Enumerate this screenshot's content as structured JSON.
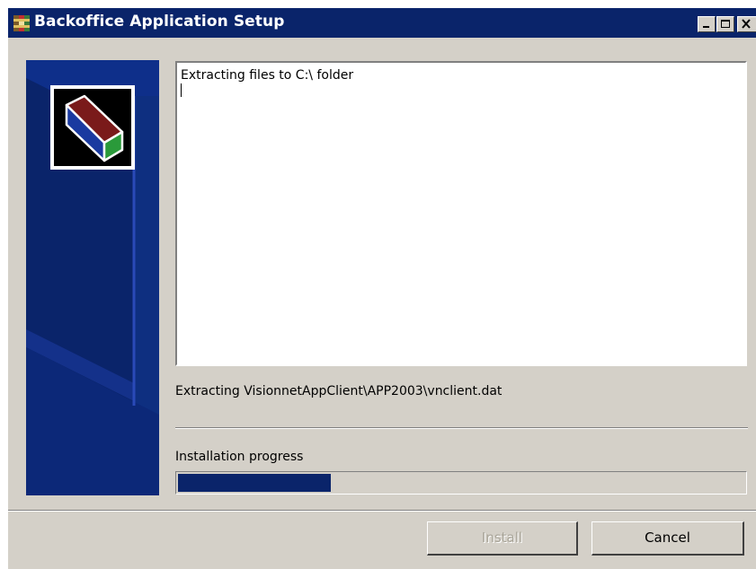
{
  "window": {
    "title": "Backoffice Application Setup",
    "icon": "installer-box-icon"
  },
  "titlebar_buttons": [
    {
      "name": "minimize-button",
      "icon": "minimize-icon"
    },
    {
      "name": "maximize-button",
      "icon": "maximize-icon"
    },
    {
      "name": "close-button",
      "icon": "close-icon"
    }
  ],
  "side_panel": {
    "logo_icon": "package-box-icon",
    "colors": {
      "background": "#0a246a",
      "accent": "#1a2ea0"
    }
  },
  "log": {
    "line1": "Extracting files to C:\\ folder"
  },
  "status": {
    "current_file": "Extracting VisionnetAppClient\\APP2003\\vnclient.dat"
  },
  "progress": {
    "label": "Installation progress",
    "fraction": 0.27,
    "color": "#0a246a"
  },
  "buttons": {
    "install": {
      "label": "Install",
      "enabled": false
    },
    "cancel": {
      "label": "Cancel",
      "enabled": true
    }
  }
}
